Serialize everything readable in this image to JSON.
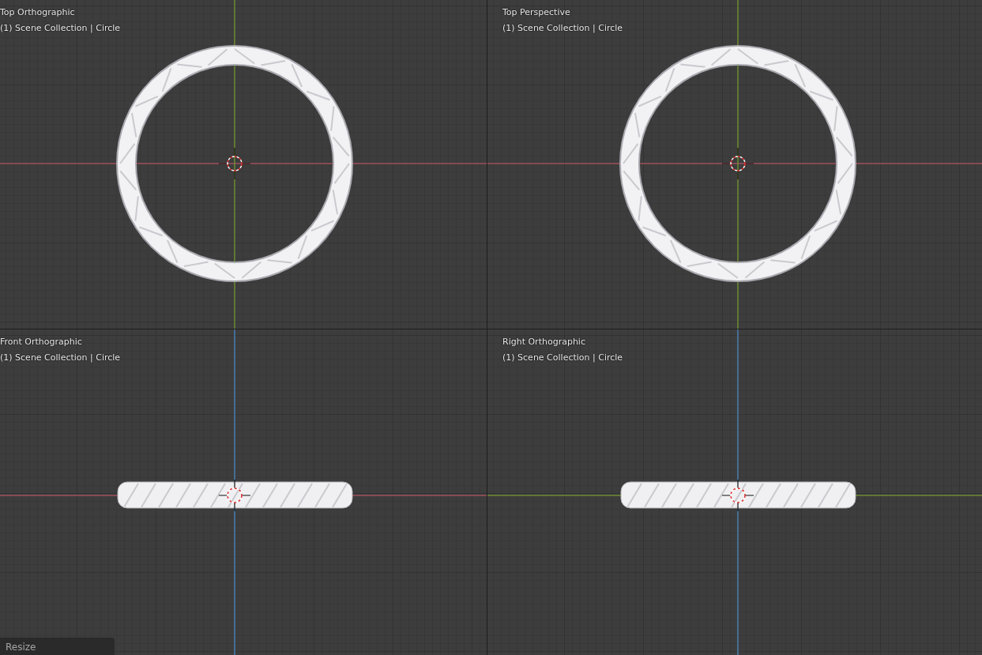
{
  "viewports": [
    {
      "title": "Top Orthographic",
      "subtitle": "(1) Scene Collection | Circle",
      "kind": "top"
    },
    {
      "title": "Top Perspective",
      "subtitle": "(1) Scene Collection | Circle",
      "kind": "perspective"
    },
    {
      "title": "Front Orthographic",
      "subtitle": "(1) Scene Collection | Circle",
      "kind": "front"
    },
    {
      "title": "Right Orthographic",
      "subtitle": "(1) Scene Collection | Circle",
      "kind": "side"
    }
  ],
  "operator_panel": {
    "label": "Resize"
  }
}
